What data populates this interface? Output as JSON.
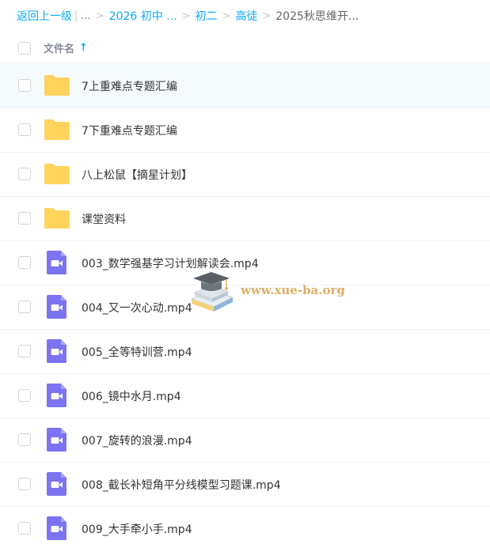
{
  "breadcrumb": {
    "back": "返回上一级",
    "pipe": "|",
    "ellipsis": "...",
    "items": [
      "2026 初中 ...",
      "初二",
      "高徒"
    ],
    "current": "2025秋思维开...",
    "separator": ">"
  },
  "header": {
    "column_label": "文件名",
    "sort_icon": "sort-ascending-arrow-icon",
    "sort_glyph": "↑"
  },
  "files": [
    {
      "name": "7上重难点专题汇编",
      "type": "folder",
      "icon": "folder-icon"
    },
    {
      "name": "7下重难点专题汇编",
      "type": "folder",
      "icon": "folder-icon"
    },
    {
      "name": "八上松鼠【摘星计划】",
      "type": "folder",
      "icon": "folder-icon"
    },
    {
      "name": "课堂资料",
      "type": "folder",
      "icon": "folder-icon"
    },
    {
      "name": "003_数学强基学习计划解读会.mp4",
      "type": "video",
      "icon": "video-file-icon"
    },
    {
      "name": "004_又一次心动.mp4",
      "type": "video",
      "icon": "video-file-icon"
    },
    {
      "name": "005_全等特训营.mp4",
      "type": "video",
      "icon": "video-file-icon"
    },
    {
      "name": "006_镜中水月.mp4",
      "type": "video",
      "icon": "video-file-icon"
    },
    {
      "name": "007_旋转的浪漫.mp4",
      "type": "video",
      "icon": "video-file-icon"
    },
    {
      "name": "008_截长补短角平分线模型习题课.mp4",
      "type": "video",
      "icon": "video-file-icon"
    },
    {
      "name": "009_大手牵小手.mp4",
      "type": "video",
      "icon": "video-file-icon"
    }
  ],
  "watermark": {
    "text": "www.xue-ba.org",
    "icon": "graduation-cap-books-logo-icon"
  },
  "colors": {
    "link": "#09aaff",
    "folder": "#ffd35c",
    "video": "#7b73f0",
    "row_highlight": "#f5faff"
  }
}
